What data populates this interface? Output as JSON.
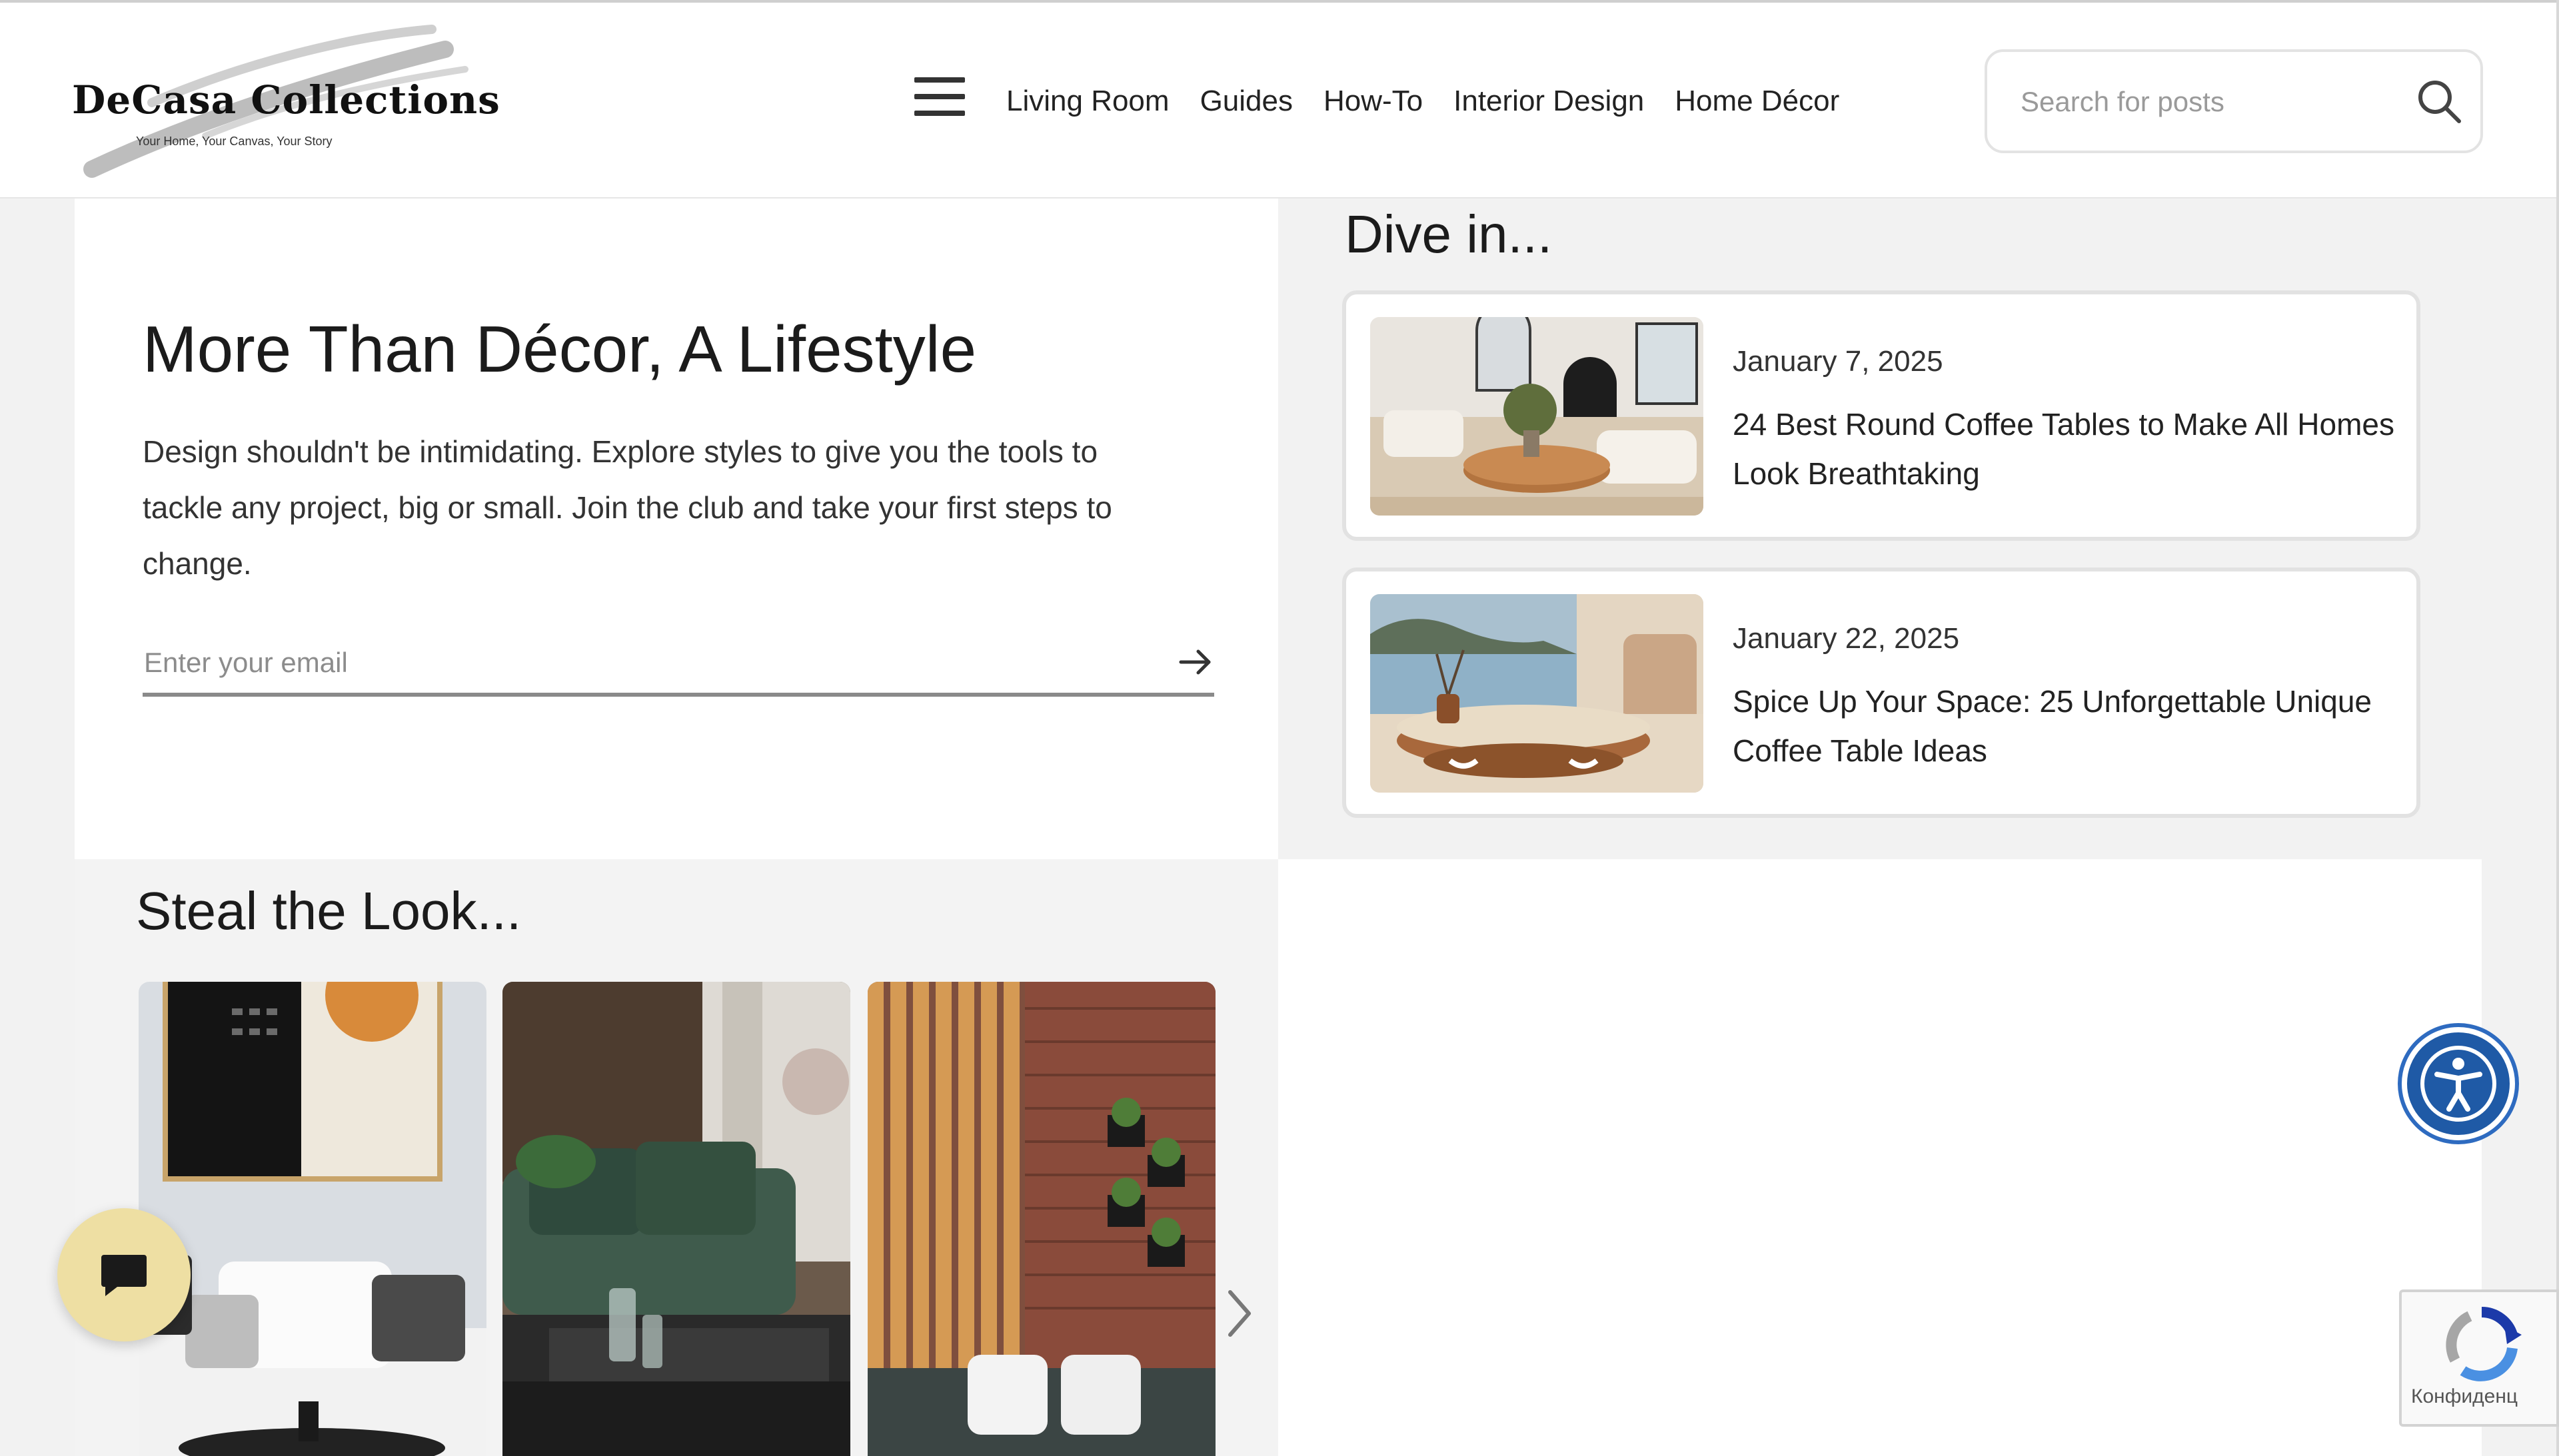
{
  "header": {
    "logo_title": "DeCasa Collections",
    "logo_tagline": "Your Home, Your Canvas, Your Story",
    "nav": [
      "Living Room",
      "Guides",
      "How-To",
      "Interior Design",
      "Home Décor"
    ],
    "search_placeholder": "Search for posts"
  },
  "hero": {
    "title": "More Than Décor, A Lifestyle",
    "description": "Design shouldn't be intimidating. Explore styles to give you the tools to tackle any project, big or small. Join the club and take your first steps to change.",
    "email_placeholder": "Enter your email"
  },
  "dive_in": {
    "heading": "Dive in...",
    "posts": [
      {
        "date": "January 7, 2025",
        "title": "24 Best Round Coffee Tables to Make All Homes Look Breathtaking"
      },
      {
        "date": "January 22, 2025",
        "title": "Spice Up Your Space: 25 Unforgettable Unique Coffee Table Ideas"
      }
    ]
  },
  "steal_the_look": {
    "heading": "Steal the Look..."
  },
  "recaptcha": {
    "label": "Конфиденц"
  },
  "colors": {
    "chat_button": "#eedfa3",
    "accessibility_button": "#1f5aa6",
    "page_background": "#f2f2f2"
  }
}
